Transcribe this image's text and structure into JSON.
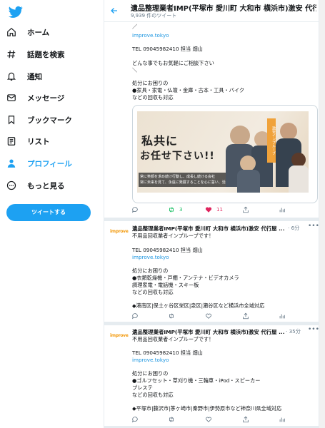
{
  "app": {
    "brand_color": "#1da1f2"
  },
  "sidebar": {
    "logo_icon": "twitter-bird-icon",
    "items": [
      {
        "label": "ホーム",
        "icon": "home-icon"
      },
      {
        "label": "話題を検索",
        "icon": "hashtag-icon"
      },
      {
        "label": "通知",
        "icon": "bell-icon"
      },
      {
        "label": "メッセージ",
        "icon": "mail-icon"
      },
      {
        "label": "ブックマーク",
        "icon": "bookmark-icon"
      },
      {
        "label": "リスト",
        "icon": "list-icon"
      },
      {
        "label": "プロフィール",
        "icon": "person-icon",
        "active": true
      },
      {
        "label": "もっと見る",
        "icon": "more-circle-icon"
      }
    ],
    "tweet_button": "ツイートする"
  },
  "header": {
    "title": "遺品整理業者IMP(平塚市 愛川町 大和市 横浜市)激安 代行屋 ...",
    "subtitle": "9,939 件のツイート"
  },
  "tweets": [
    {
      "lines": [
        "／",
        "",
        "improve.tokyo",
        "",
        "TEL 09045982410 担当 畑山",
        "",
        "どんな事でもお気軽にご相談下さい",
        "＼",
        "",
        "処分にお困りの",
        "●家具・家電・仏壇・金庫・古本・工具・バイク",
        "などの回収も対応"
      ],
      "banner": {
        "headline1": "私共に",
        "headline2": "お任せ下さい!!",
        "caption1": "常に笑顔を求め続け行動し、成長し続ける会社",
        "caption2": "常に未来を見て、永遠に発展することを心に誓い、活動し続けます。",
        "side_badge": "激安インプルーブ"
      },
      "actions": {
        "reply": "",
        "retweet": "3",
        "like": "11",
        "share": "",
        "analytics": ""
      }
    },
    {
      "author": "遺品整理業者IMP(平塚市 愛川町 大和市 横浜市)激安 代行屋 ...",
      "time": "· 6分",
      "avatar_text": "improve",
      "lines": [
        "不用品回収業者インプルーブです！",
        "",
        "TEL 09045982410 担当 畑山",
        "improve.tokyo",
        "",
        "処分にお困りの",
        "●衣類乾燥機・戸棚・アンテナ・ビデオカメラ",
        "調理家電・電話機・スキー板",
        "などの回収も対応",
        "",
        "◆港南区|保土ヶ谷区栄区|泉区|瀬谷区など横浜市全域対応"
      ]
    },
    {
      "author": "遺品整理業者IMP(平塚市 愛川町 大和市 横浜市)激安 代行屋 ...",
      "time": "· 35分",
      "avatar_text": "improve",
      "lines": [
        "不用品回収業者インプルーブです！",
        "",
        "TEL 09045982410 担当 畑山",
        "improve.tokyo",
        "",
        "処分にお困りの",
        "●ゴルフセット・草刈り機・三輪車・iPod・スピーカー",
        "プレステ",
        "などの回収も対応",
        "",
        "◆平塚市|藤沢市|茅ヶ崎市|秦野市|伊勢原市など神奈川県全域対応"
      ]
    }
  ]
}
